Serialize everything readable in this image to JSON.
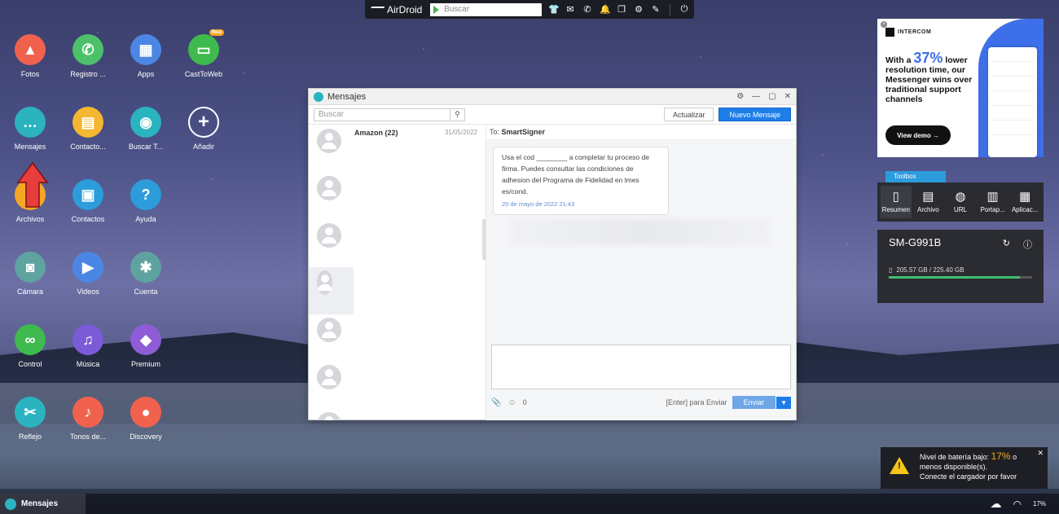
{
  "topbar": {
    "logo": "AirDroid",
    "search_placeholder": "Buscar"
  },
  "desktop_icons": [
    {
      "label": "Fotos",
      "color": "#f0624d",
      "icon": "photo-icon",
      "glyph": "▲"
    },
    {
      "label": "Registro ...",
      "color": "#4cc16a",
      "icon": "phone-icon",
      "glyph": "✆"
    },
    {
      "label": "Apps",
      "color": "#4c86e4",
      "icon": "apps-icon",
      "glyph": "▦"
    },
    {
      "label": "CastToWeb",
      "color": "#3fba4e",
      "icon": "cast-icon",
      "glyph": "▭",
      "badge": "New"
    },
    {
      "label": "Mensajes",
      "color": "#2bb3c0",
      "icon": "message-icon",
      "glyph": "…"
    },
    {
      "label": "Contacto...",
      "color": "#f5b731",
      "icon": "contact-card-icon",
      "glyph": "▤"
    },
    {
      "label": "Buscar T...",
      "color": "#2bb3c0",
      "icon": "location-pin-icon",
      "glyph": "◉"
    },
    {
      "label": "Añadir",
      "color": "transparent",
      "icon": "plus-icon",
      "glyph": "+"
    },
    {
      "label": "Archivos",
      "color": "#f5a623",
      "icon": "folder-icon",
      "glyph": ""
    },
    {
      "label": "Contactos",
      "color": "#2d9cdb",
      "icon": "contacts-icon",
      "glyph": "▣"
    },
    {
      "label": "Ayuda",
      "color": "#2d9cdb",
      "icon": "help-icon",
      "glyph": "?"
    },
    {
      "label": "Cámara",
      "color": "#5fa3a1",
      "icon": "camera-icon",
      "glyph": "◙"
    },
    {
      "label": "Videos",
      "color": "#4c86e4",
      "icon": "video-icon",
      "glyph": "▶"
    },
    {
      "label": "Cuenta",
      "color": "#5fa3a1",
      "icon": "gear-icon",
      "glyph": "✱"
    },
    {
      "label": "Control",
      "color": "#3fba4e",
      "icon": "binoculars-icon",
      "glyph": "∞"
    },
    {
      "label": "Música",
      "color": "#7b5bd6",
      "icon": "music-icon",
      "glyph": "♫"
    },
    {
      "label": "Premium",
      "color": "#8d5cd6",
      "icon": "diamond-icon",
      "glyph": "◆"
    },
    {
      "label": "Reflejo",
      "color": "#2bb3c0",
      "icon": "scissors-icon",
      "glyph": "✂"
    },
    {
      "label": "Tonos de...",
      "color": "#f0624d",
      "icon": "bell-icon",
      "glyph": "♪"
    },
    {
      "label": "Discovery",
      "color": "#f0624d",
      "icon": "planet-icon",
      "glyph": "●"
    }
  ],
  "messages_window": {
    "title": "Mensajes",
    "search_placeholder": "Buscar",
    "update_label": "Actualizar",
    "new_message_label": "Nuevo Mensaje",
    "conversations": [
      {
        "name": "Amazon (22)",
        "date": "31/05/2022"
      },
      {
        "name": "",
        "date": ""
      },
      {
        "name": "",
        "date": ""
      },
      {
        "name": "",
        "date": ""
      },
      {
        "name": "",
        "date": ""
      },
      {
        "name": "",
        "date": ""
      },
      {
        "name": "",
        "date": ""
      }
    ],
    "to_prefix": "To:",
    "to_name": "SmartSigner",
    "message_text": "Usa el cod ________ a completar tu proceso de firma. Puedes consultar las condiciones de adhesion del Programa de Fidelidad en lmes es/cond.",
    "message_time": "20 de mayo de 2022 21:43",
    "char_count": "0",
    "enter_hint": "[Enter] para Enviar",
    "send_label": "Enviar"
  },
  "ad": {
    "brand": "INTERCOM",
    "headline_pre": "With a",
    "headline_pct": "37%",
    "headline_post": "lower resolution time, our Messenger wins over traditional support channels",
    "cta": "View demo →"
  },
  "toolbox": {
    "tab_label": "Toolbox",
    "items": [
      {
        "label": "Resumen",
        "icon": "phone-icon",
        "glyph": "▯"
      },
      {
        "label": "Archivo",
        "icon": "file-icon",
        "glyph": "▤"
      },
      {
        "label": "URL",
        "icon": "globe-icon",
        "glyph": "◍"
      },
      {
        "label": "Portap...",
        "icon": "clipboard-icon",
        "glyph": "▥"
      },
      {
        "label": "Aplicac...",
        "icon": "apps-icon",
        "glyph": "▦"
      }
    ]
  },
  "device": {
    "name": "SM-G991B",
    "storage_text": "205.57 GB / 225.40 GB",
    "storage_fraction": 0.912
  },
  "battery_toast": {
    "line1_pre": "Nivel de batería bajo:",
    "pct": "17%",
    "line1_post": "o",
    "line2": "menos disponible(s).",
    "line3": "Conecte el cargador por favor"
  },
  "taskbar": {
    "app_label": "Mensajes",
    "battery": "17%"
  }
}
